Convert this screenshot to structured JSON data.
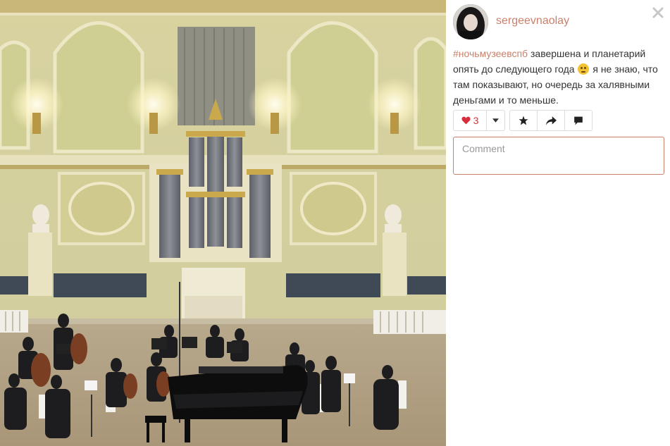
{
  "post": {
    "username": "sergeevnaolay",
    "caption_tag": "#ночьмузеевспб",
    "caption_text_1": "завершена и планетарий опять до следующего года",
    "caption_text_2": "я не знаю, что там показывают, но очередь за халявными деньгами и то меньше.",
    "emoji": "sad-face-emoji"
  },
  "actions": {
    "like_count": "3",
    "like_icon": "heart-icon",
    "caret_icon": "caret-down-icon",
    "favorite_icon": "star-icon",
    "share_icon": "share-arrow-icon",
    "comment_icon": "speech-bubble-icon"
  },
  "comment": {
    "placeholder": "Comment"
  },
  "window": {
    "close_icon": "close-icon"
  },
  "colors": {
    "accent": "#c9806b",
    "like": "#d52f3c"
  }
}
